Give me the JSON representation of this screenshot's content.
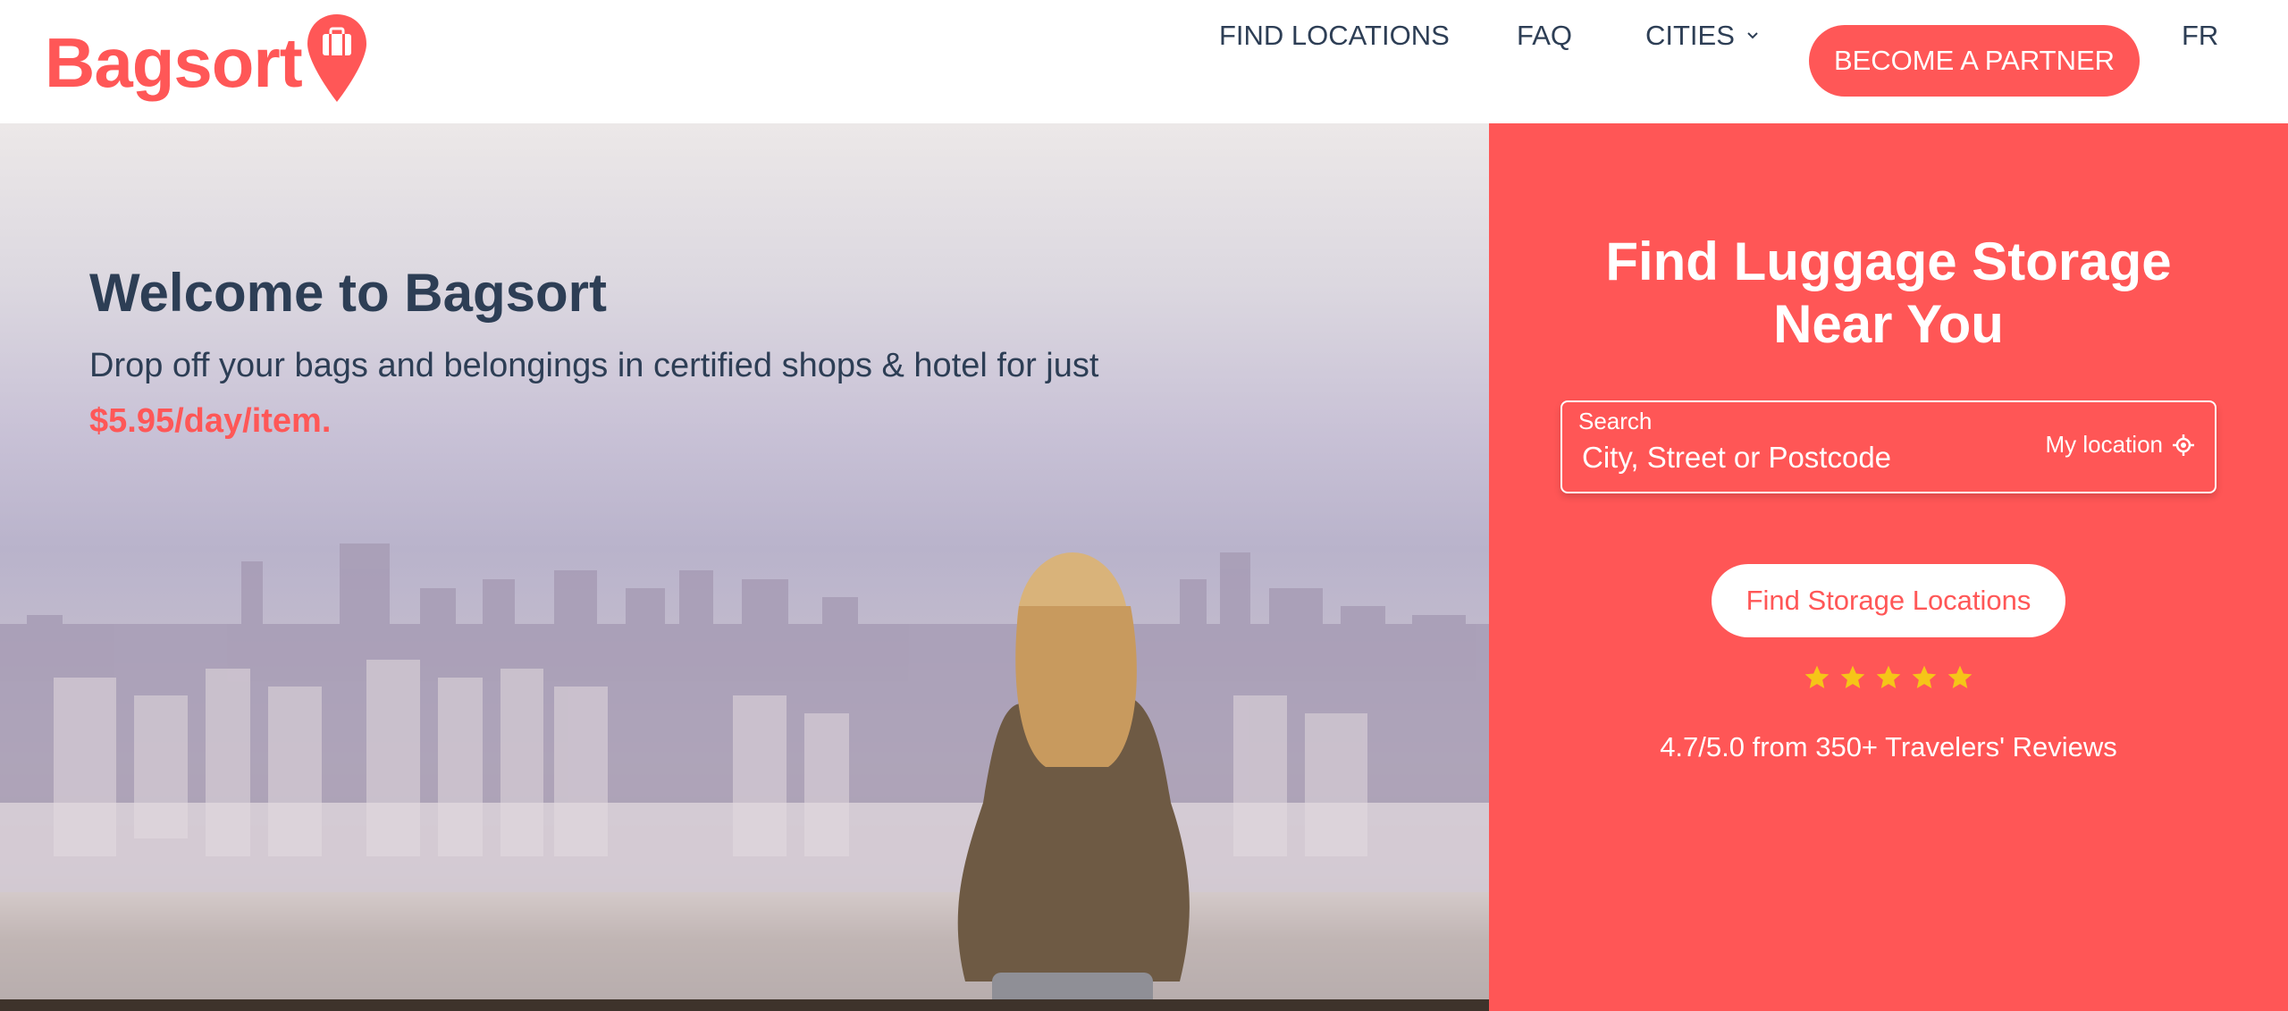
{
  "brand": {
    "name": "Bagsort",
    "accent": "#ff5757"
  },
  "nav": {
    "find_locations": "FIND LOCATIONS",
    "faq": "FAQ",
    "cities": "CITIES",
    "become_partner": "BECOME A PARTNER",
    "language": "FR"
  },
  "hero": {
    "title": "Welcome to Bagsort",
    "subtitle": "Drop off your bags and belongings in certified shops & hotel for just",
    "price": "$5.95/day/item."
  },
  "search_panel": {
    "title_line1": "Find Luggage Storage",
    "title_line2": "Near You",
    "search_label": "Search",
    "search_placeholder": "City, Street or Postcode",
    "my_location": "My location",
    "find_button": "Find Storage Locations",
    "stars": 5,
    "rating_text": "4.7/5.0 from 350+ Travelers' Reviews",
    "panel_color": "#ff5656",
    "star_color": "#f5c518"
  },
  "icons": [
    "luggage-pin-icon",
    "chevron-down-icon",
    "crosshair-location-icon",
    "star-icon"
  ]
}
